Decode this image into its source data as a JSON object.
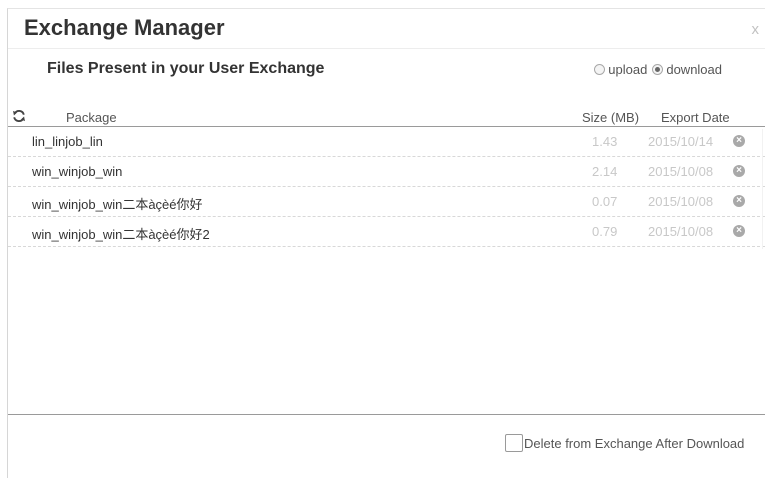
{
  "dialog": {
    "title": "Exchange Manager",
    "close_label": "x",
    "subtitle": "Files Present in your User Exchange"
  },
  "mode": {
    "options": [
      {
        "label": "upload",
        "selected": false
      },
      {
        "label": "download",
        "selected": true
      }
    ]
  },
  "table": {
    "refresh_icon": "refresh-icon",
    "columns": {
      "package": "Package",
      "size": "Size (MB)",
      "date": "Export Date"
    },
    "rows": [
      {
        "name": "lin_linjob_lin",
        "size": "1.43",
        "date": "2015/10/14"
      },
      {
        "name": "win_winjob_win",
        "size": "2.14",
        "date": "2015/10/08"
      },
      {
        "name": "win_winjob_win二本àçèé你好",
        "size": "0.07",
        "date": "2015/10/08"
      },
      {
        "name": "win_winjob_win二本àçèé你好2",
        "size": "0.79",
        "date": "2015/10/08"
      }
    ],
    "delete_icon": "remove-icon"
  },
  "footer": {
    "delete_after_download_label": "Delete from Exchange After Download",
    "delete_after_download_checked": false
  }
}
